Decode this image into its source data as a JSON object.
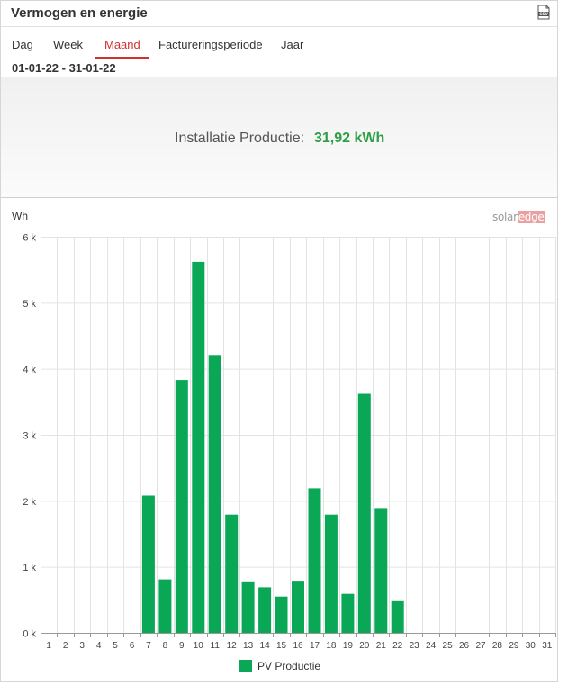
{
  "header": {
    "title": "Vermogen en energie",
    "csv_icon": "csv-download-icon"
  },
  "tabs": [
    {
      "label": "Dag",
      "active": false
    },
    {
      "label": "Week",
      "active": false
    },
    {
      "label": "Maand",
      "active": true
    },
    {
      "label": "Factureringsperiode",
      "active": false
    },
    {
      "label": "Jaar",
      "active": false
    }
  ],
  "date_range": "01-01-22 - 31-01-22",
  "summary": {
    "label": "Installatie Productie:",
    "value": "31,92 kWh"
  },
  "logo": {
    "part1": "solar",
    "part2": "edge"
  },
  "colors": {
    "accent": "#d0312d",
    "bar": "#0aa856",
    "value": "#2e9e46"
  },
  "chart_data": {
    "type": "bar",
    "ylabel": "Wh",
    "ylim": [
      0,
      6000
    ],
    "y_ticks": [
      0,
      1000,
      2000,
      3000,
      4000,
      5000,
      6000
    ],
    "y_tick_labels": [
      "0 k",
      "1 k",
      "2 k",
      "3 k",
      "4 k",
      "5 k",
      "6 k"
    ],
    "categories": [
      "1",
      "2",
      "3",
      "4",
      "5",
      "6",
      "7",
      "8",
      "9",
      "10",
      "11",
      "12",
      "13",
      "14",
      "15",
      "16",
      "17",
      "18",
      "19",
      "20",
      "21",
      "22",
      "23",
      "24",
      "25",
      "26",
      "27",
      "28",
      "29",
      "30",
      "31"
    ],
    "series": [
      {
        "name": "PV Productie",
        "values": [
          0,
          0,
          0,
          0,
          0,
          0,
          2080,
          810,
          3830,
          5620,
          4210,
          1790,
          780,
          690,
          550,
          790,
          2190,
          1790,
          590,
          3620,
          1890,
          480,
          0,
          0,
          0,
          0,
          0,
          0,
          0,
          0,
          0
        ]
      }
    ],
    "grid": true,
    "legend": "bottom"
  }
}
